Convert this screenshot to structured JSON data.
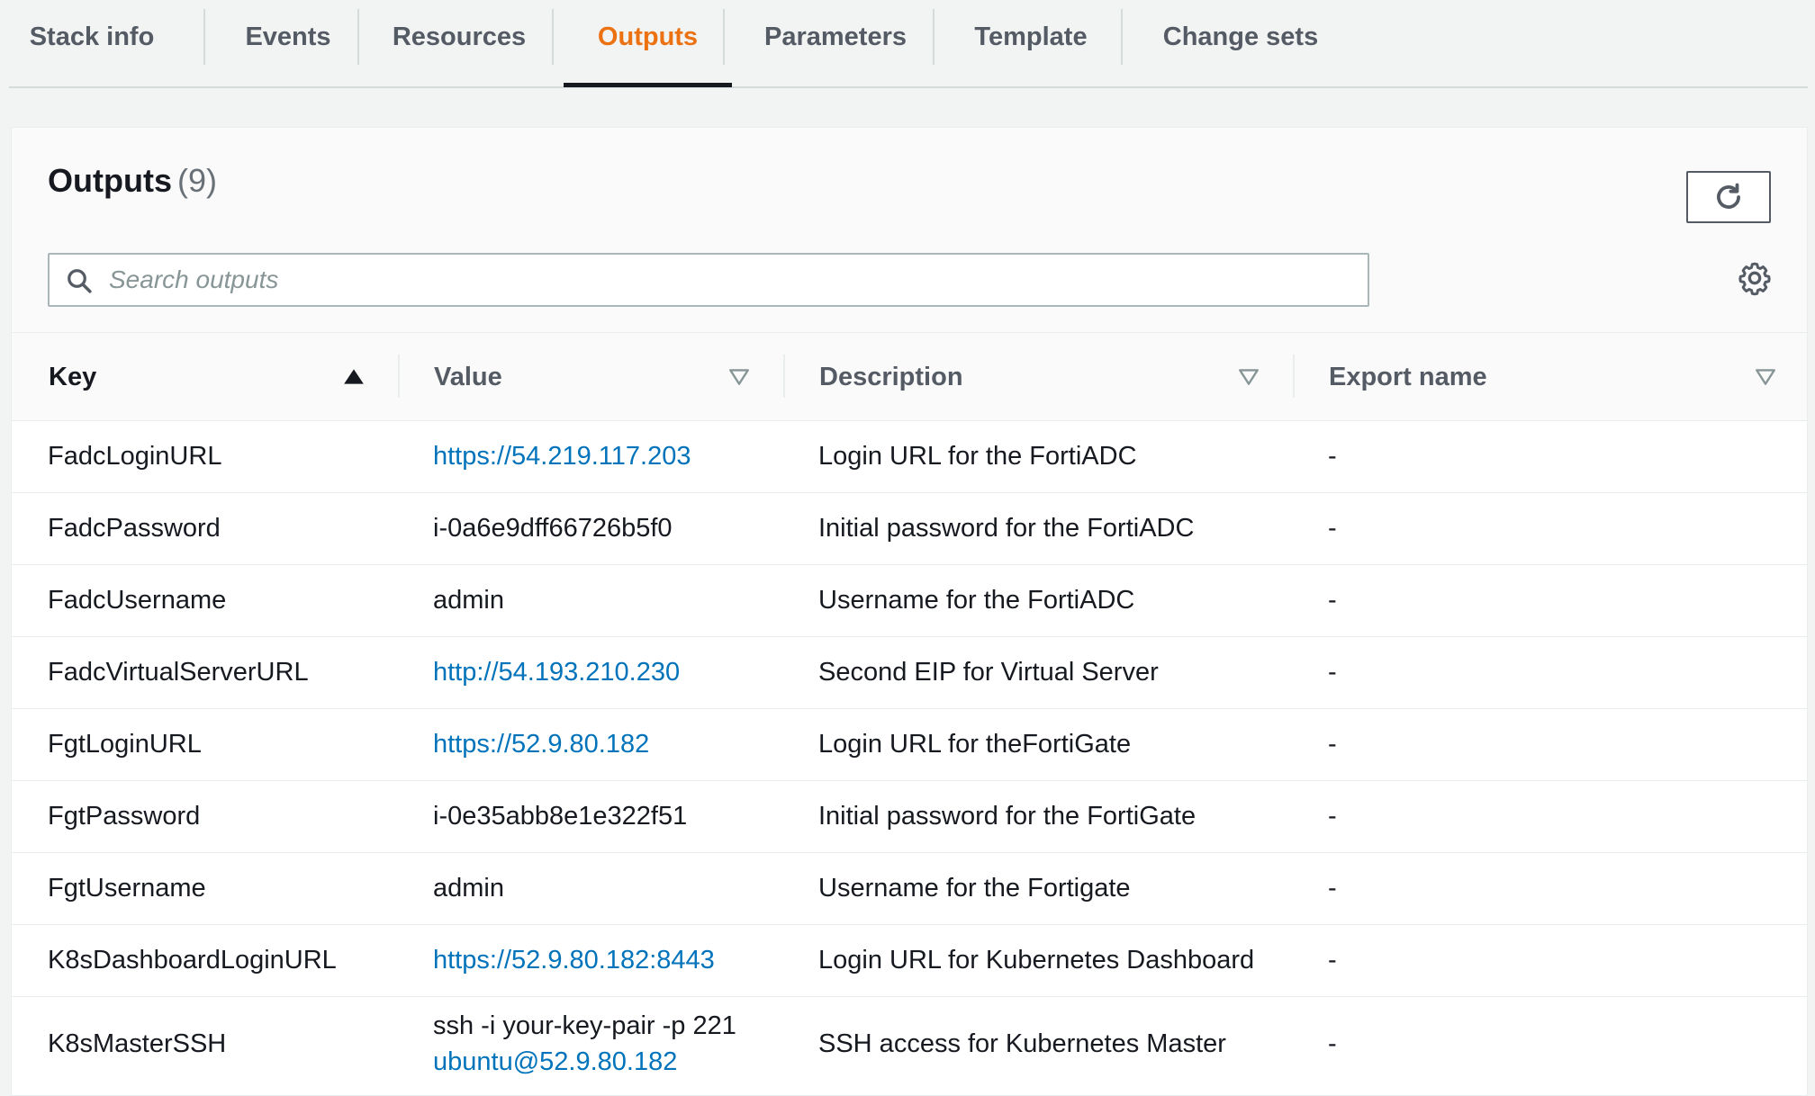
{
  "tabs": [
    {
      "label": "Stack info"
    },
    {
      "label": "Events"
    },
    {
      "label": "Resources"
    },
    {
      "label": "Outputs",
      "active": true
    },
    {
      "label": "Parameters"
    },
    {
      "label": "Template"
    },
    {
      "label": "Change sets"
    }
  ],
  "panel": {
    "title": "Outputs",
    "count": "(9)"
  },
  "search": {
    "placeholder": "Search outputs",
    "value": ""
  },
  "table": {
    "headers": {
      "key": "Key",
      "value": "Value",
      "description": "Description",
      "export_name": "Export name"
    },
    "rows": [
      {
        "key": "FadcLoginURL",
        "value": "https://54.219.117.203",
        "value_is_link": true,
        "description": "Login URL for the FortiADC",
        "export_name": "-"
      },
      {
        "key": "FadcPassword",
        "value": "i-0a6e9dff66726b5f0",
        "value_is_link": false,
        "description": "Initial password for the FortiADC",
        "export_name": "-"
      },
      {
        "key": "FadcUsername",
        "value": "admin",
        "value_is_link": false,
        "description": "Username for the FortiADC",
        "export_name": "-"
      },
      {
        "key": "FadcVirtualServerURL",
        "value": "http://54.193.210.230",
        "value_is_link": true,
        "description": "Second EIP for Virtual Server",
        "export_name": "-"
      },
      {
        "key": "FgtLoginURL",
        "value": "https://52.9.80.182",
        "value_is_link": true,
        "description": "Login URL for theFortiGate",
        "export_name": "-"
      },
      {
        "key": "FgtPassword",
        "value": "i-0e35abb8e1e322f51",
        "value_is_link": false,
        "description": "Initial password for the FortiGate",
        "export_name": "-"
      },
      {
        "key": "FgtUsername",
        "value": "admin",
        "value_is_link": false,
        "description": "Username for the Fortigate",
        "export_name": "-"
      },
      {
        "key": "K8sDashboardLoginURL",
        "value": "https://52.9.80.182:8443",
        "value_is_link": true,
        "description": "Login URL for Kubernetes Dashboard",
        "export_name": "-"
      },
      {
        "key": "K8sMasterSSH",
        "value_line1": "ssh -i your-key-pair -p 221",
        "value_line2": "ubuntu@52.9.80.182",
        "description": "SSH access for Kubernetes Master",
        "export_name": "-"
      }
    ]
  },
  "colors": {
    "accent_orange": "#ec7211",
    "link_blue": "#0073bb",
    "text_dark": "#16191f",
    "text_muted": "#545b64"
  },
  "icons": {
    "refresh": "refresh-icon",
    "search": "search-icon",
    "settings": "gear-icon",
    "sort_ascending": "sort-ascending-icon",
    "sort_descending": "sort-descending-icon"
  }
}
